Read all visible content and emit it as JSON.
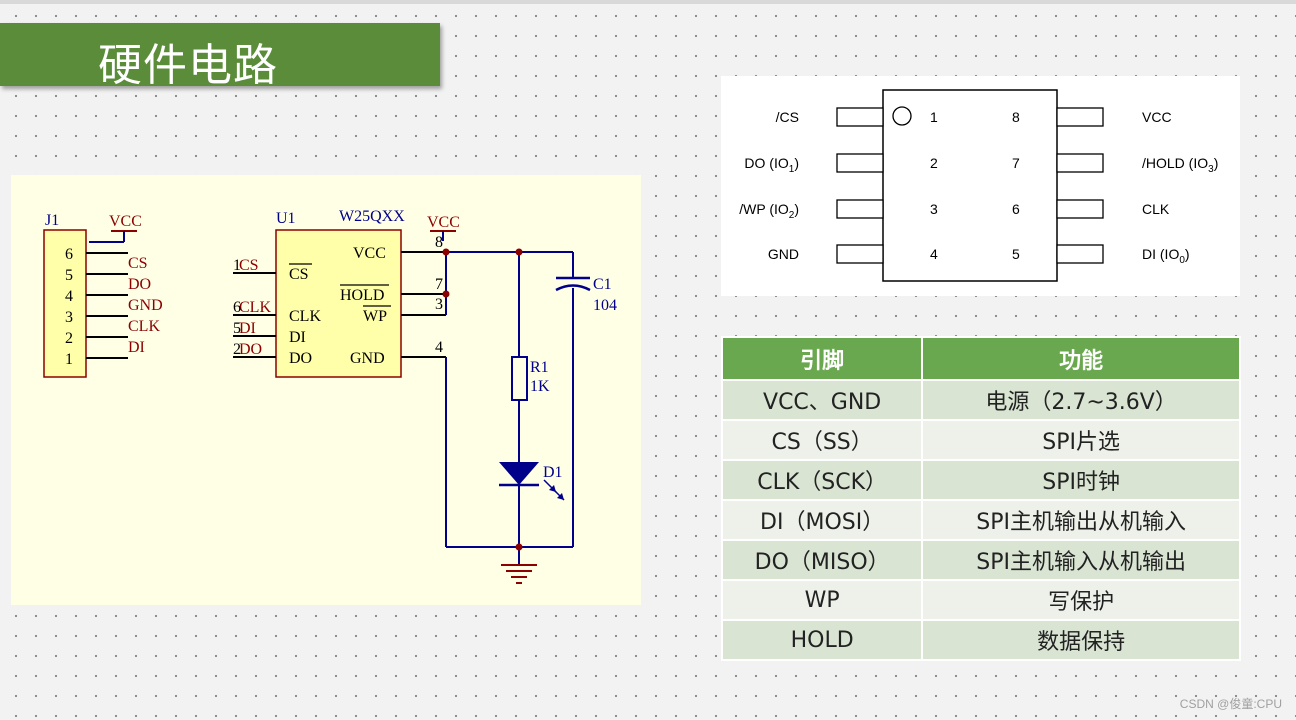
{
  "slide_title": "硬件电路",
  "schematic": {
    "connector": {
      "ref": "J1",
      "vcc_label": "VCC",
      "pin_numbers": [
        "6",
        "5",
        "4",
        "3",
        "2",
        "1"
      ],
      "nets": [
        "CS",
        "DO",
        "GND",
        "CLK",
        "DI"
      ]
    },
    "chip": {
      "ref": "U1",
      "part": "W25QXX",
      "vcc_label": "VCC",
      "left_pins": [
        "CS",
        "CLK",
        "DI",
        "DO"
      ],
      "right_pins": [
        "VCC",
        "HOLD",
        "WP",
        "GND"
      ],
      "right_pin_numbers": [
        "8",
        "7",
        "3",
        "4"
      ],
      "left_nets": [
        "CS",
        "CLK",
        "DI",
        "DO"
      ],
      "left_pin_numbers": [
        "1",
        "6",
        "5",
        "2"
      ]
    },
    "resistor": {
      "ref": "R1",
      "value": "1K"
    },
    "capacitor": {
      "ref": "C1",
      "value": "104"
    },
    "led": {
      "ref": "D1"
    }
  },
  "pinout": {
    "left": [
      {
        "num": "1",
        "name": "/CS",
        "sub": ""
      },
      {
        "num": "2",
        "name": "DO (IO",
        "sub": "1"
      },
      {
        "num": "3",
        "name": "/WP (IO",
        "sub": "2"
      },
      {
        "num": "4",
        "name": "GND",
        "sub": ""
      }
    ],
    "right": [
      {
        "num": "8",
        "name": "VCC",
        "sub": ""
      },
      {
        "num": "7",
        "name": "/HOLD (IO",
        "sub": "3"
      },
      {
        "num": "6",
        "name": "CLK",
        "sub": ""
      },
      {
        "num": "5",
        "name": "DI (IO",
        "sub": "0"
      }
    ]
  },
  "pin_table": {
    "headers": [
      "引脚",
      "功能"
    ],
    "rows": [
      [
        "VCC、GND",
        "电源（2.7~3.6V）"
      ],
      [
        "CS（SS）",
        "SPI片选"
      ],
      [
        "CLK（SCK）",
        "SPI时钟"
      ],
      [
        "DI（MOSI）",
        "SPI主机输出从机输入"
      ],
      [
        "DO（MISO）",
        "SPI主机输入从机输出"
      ],
      [
        "WP",
        "写保护"
      ],
      [
        "HOLD",
        "数据保持"
      ]
    ]
  },
  "watermark": "CSDN @俊童:CPU",
  "colors": {
    "title_bar": "#5b8c3a",
    "table_header": "#6aa84f",
    "table_row_odd": "#d9e4d3",
    "table_row_even": "#edf1ea",
    "schematic_bg": "#ffffe6",
    "wire": "#00008b",
    "label": "#8b0000"
  }
}
